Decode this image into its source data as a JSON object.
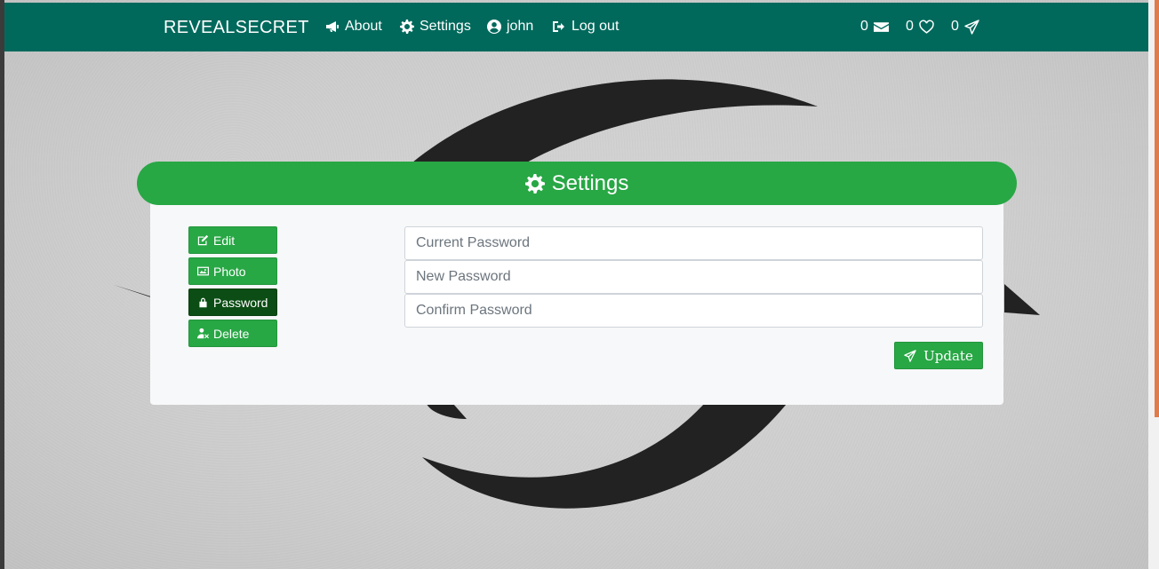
{
  "navbar": {
    "brand": "REVEALSECRET",
    "links": {
      "about": "About",
      "settings": "Settings",
      "user": "john",
      "logout": "Log out"
    },
    "counters": {
      "messages": "0",
      "likes": "0",
      "sent": "0"
    },
    "background_color": "#00695c"
  },
  "settings_card": {
    "title": "Settings",
    "header_color": "#28a745",
    "menu": [
      {
        "label": "Edit",
        "icon": "edit-icon"
      },
      {
        "label": "Photo",
        "icon": "image-icon"
      },
      {
        "label": "Password",
        "icon": "lock-icon",
        "active": true
      },
      {
        "label": "Delete",
        "icon": "user-delete-icon"
      }
    ],
    "form": {
      "current_password_placeholder": "Current Password",
      "new_password_placeholder": "New Password",
      "confirm_password_placeholder": "Confirm Password",
      "submit_label": "Update"
    }
  }
}
